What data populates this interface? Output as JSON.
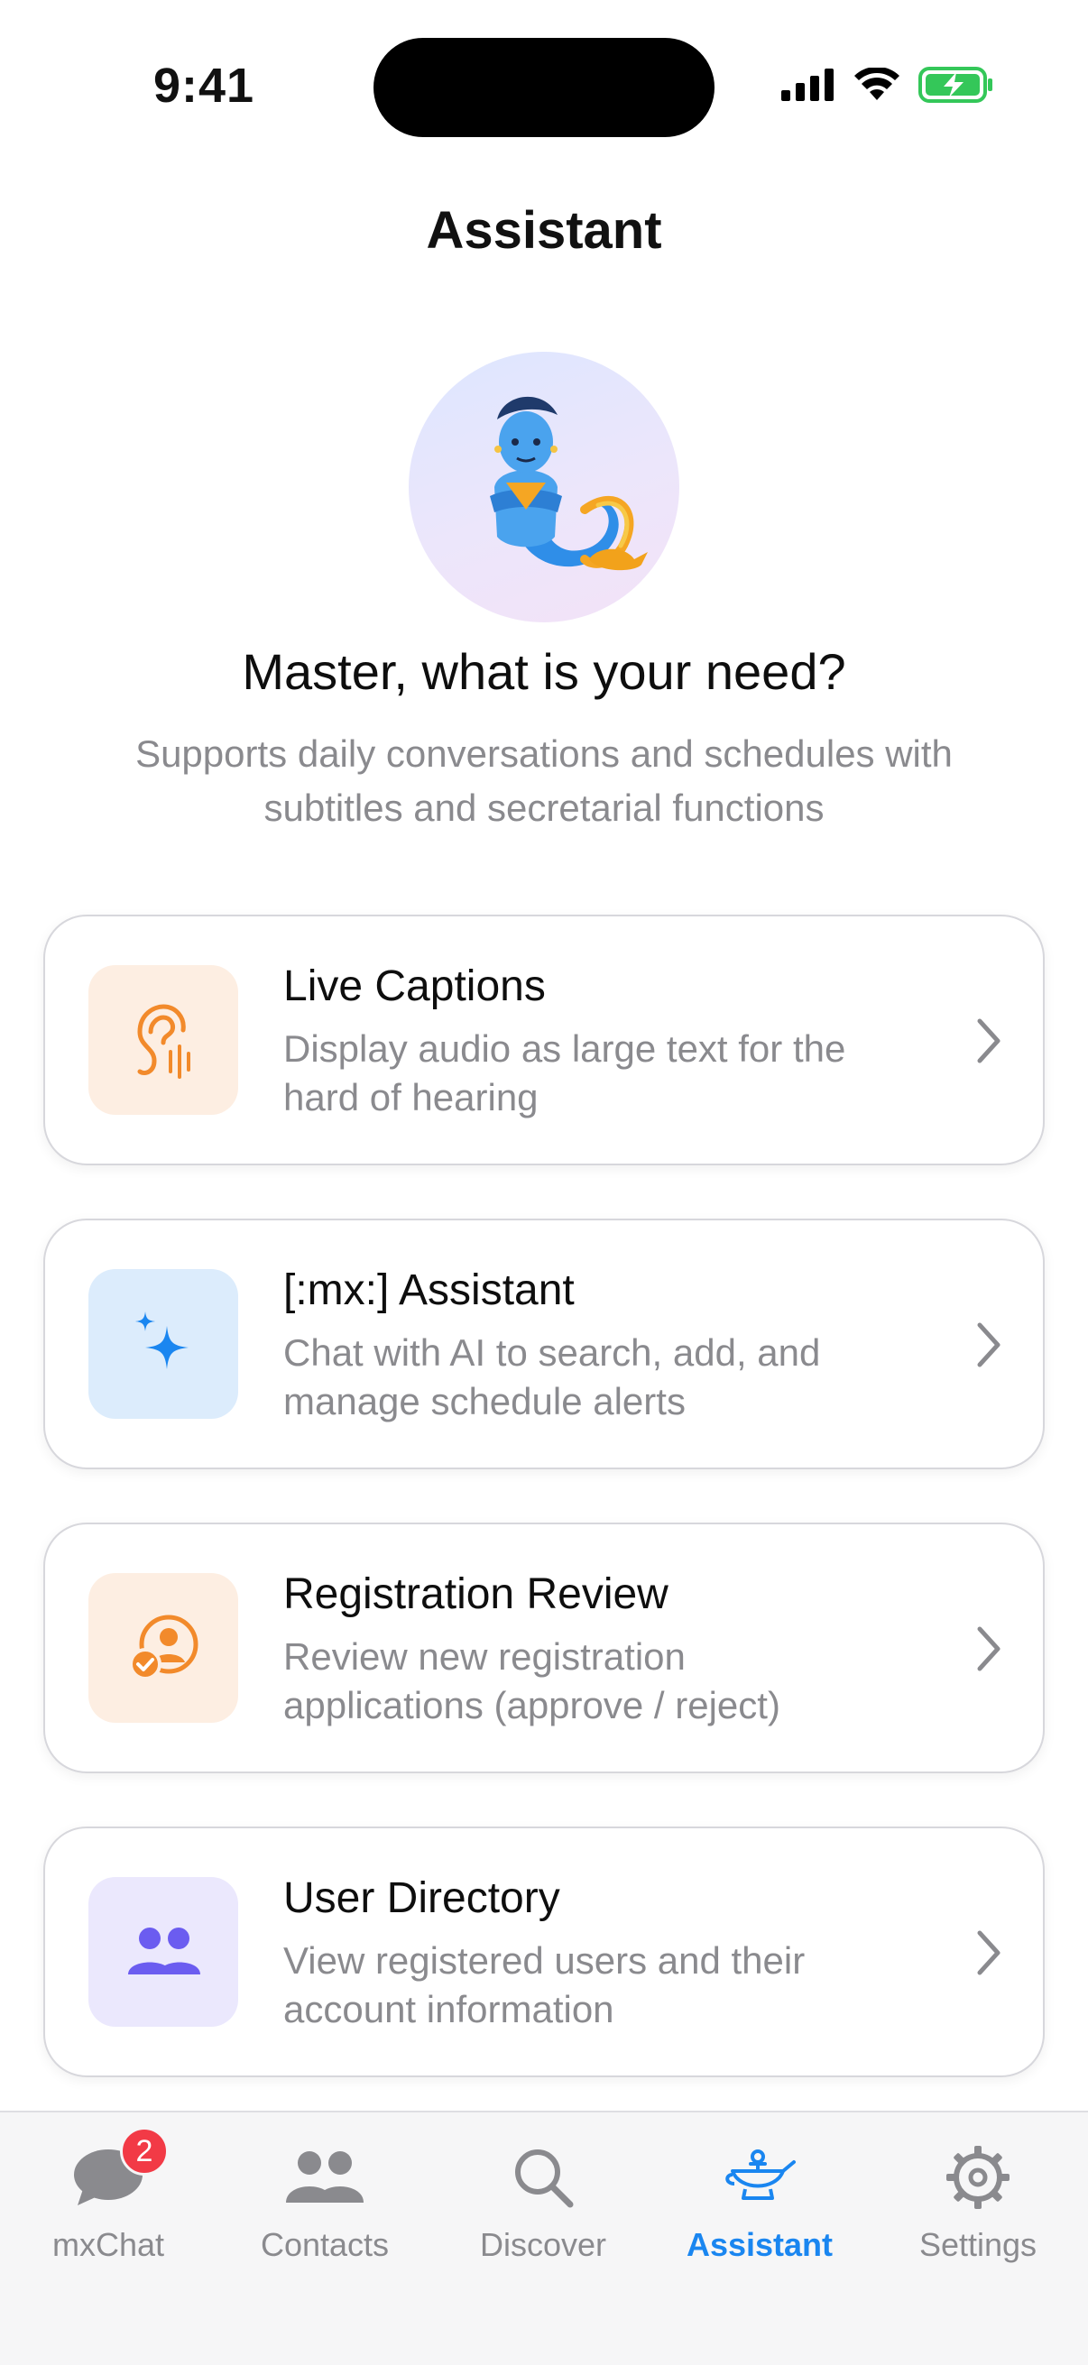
{
  "status_bar": {
    "time": "9:41"
  },
  "header": {
    "title": "Assistant"
  },
  "hero": {
    "headline": "Master, what is your need?",
    "subtitle": "Supports daily conversations and schedules with subtitles and secretarial functions"
  },
  "cards": [
    {
      "title": "Live Captions",
      "description": "Display audio as large text for the hard of hearing",
      "icon": "ear-icon",
      "icon_bg": "#fdeee2",
      "icon_color": "#f28a2b"
    },
    {
      "title": "[:mx:] Assistant",
      "description": "Chat with AI to search, add, and manage schedule alerts",
      "icon": "sparkles-icon",
      "icon_bg": "#dcecfc",
      "icon_color": "#1a86f0"
    },
    {
      "title": "Registration Review",
      "description": "Review new registration applications (approve / reject)",
      "icon": "user-check-icon",
      "icon_bg": "#fdeee2",
      "icon_color": "#f28a2b"
    },
    {
      "title": "User Directory",
      "description": "View registered users and their account information",
      "icon": "users-icon",
      "icon_bg": "#ebe8fd",
      "icon_color": "#6b5cf0"
    }
  ],
  "tabs": [
    {
      "label": "mxChat",
      "icon": "chat-bubble-icon",
      "badge": "2"
    },
    {
      "label": "Contacts",
      "icon": "contacts-icon"
    },
    {
      "label": "Discover",
      "icon": "search-icon"
    },
    {
      "label": "Assistant",
      "icon": "genie-lamp-icon",
      "active": true
    },
    {
      "label": "Settings",
      "icon": "gear-icon"
    }
  ],
  "colors": {
    "accent": "#1a86f0",
    "badge": "#f23a46",
    "secondary_text": "#8a8a8e"
  }
}
